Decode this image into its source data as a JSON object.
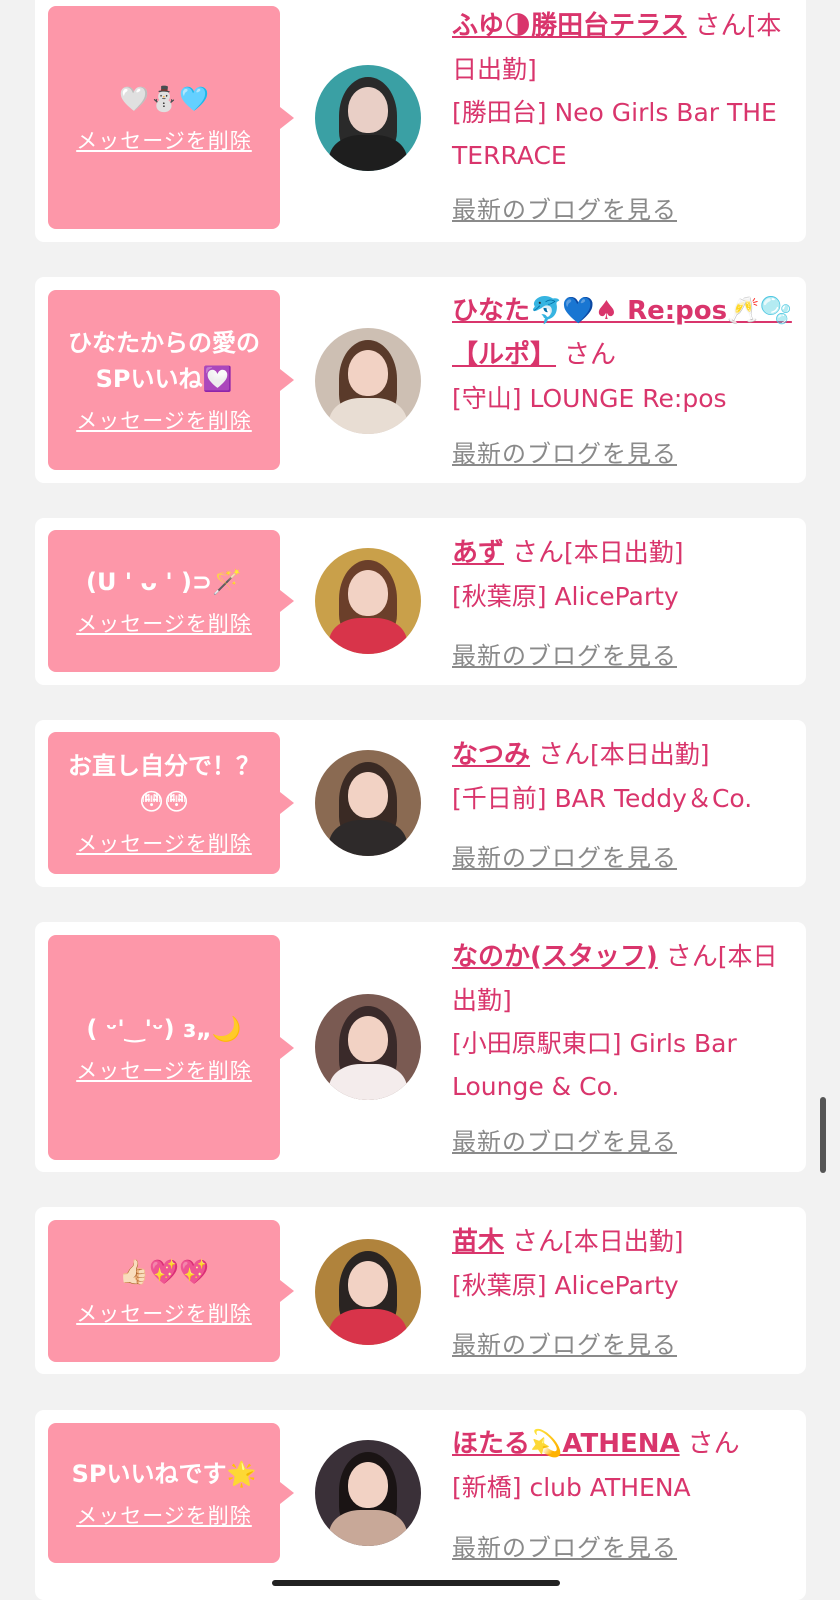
{
  "delete_label": "メッセージを削除",
  "blog_label": "最新のブログを見る",
  "san_label": "さん",
  "colors": {
    "background": "#f2f2f2",
    "card": "#ffffff",
    "bubble": "#fd97a9",
    "accent": "#d9356c",
    "muted": "#8a8a8a"
  },
  "items": [
    {
      "message": "🤍⛄🩵",
      "name": "ふゆ🌗勝田台テラス",
      "status": "[本日出勤]",
      "shop": "[勝田台] Neo Girls Bar THE TERRACE",
      "avatar_icon": "profile-photo"
    },
    {
      "message": "ひなたからの愛のSPいいね💟",
      "name": "ひなた🐬💙♠ Re:pos🥂🫧【ルポ】",
      "status": "",
      "shop": "[守山] LOUNGE Re:pos",
      "avatar_icon": "profile-photo"
    },
    {
      "message": "(U ' ᴗ ' )⊃🪄",
      "name": "あず",
      "status": "[本日出勤]",
      "shop": "[秋葉原] AliceParty",
      "avatar_icon": "profile-photo"
    },
    {
      "message": "お直し自分で！？😳😳",
      "name": "なつみ",
      "status": "[本日出勤]",
      "shop": "[千日前] BAR Teddy＆Co.",
      "avatar_icon": "profile-photo"
    },
    {
      "message": "( ᵕ'‿'ᵕ) ɜ„🌙",
      "name": "なのか(スタッフ)",
      "status": "[本日出勤]",
      "shop": "[小田原駅東口] Girls Bar Lounge & Co.",
      "avatar_icon": "profile-photo"
    },
    {
      "message": "👍🏻💖💖",
      "name": "苗木",
      "status": "[本日出勤]",
      "shop": "[秋葉原] AliceParty",
      "avatar_icon": "profile-photo"
    },
    {
      "message": "SPいいねです🌟",
      "name": "ほたる💫ATHENA",
      "status": "",
      "shop": "[新橋] club ATHENA",
      "avatar_icon": "profile-photo"
    }
  ]
}
